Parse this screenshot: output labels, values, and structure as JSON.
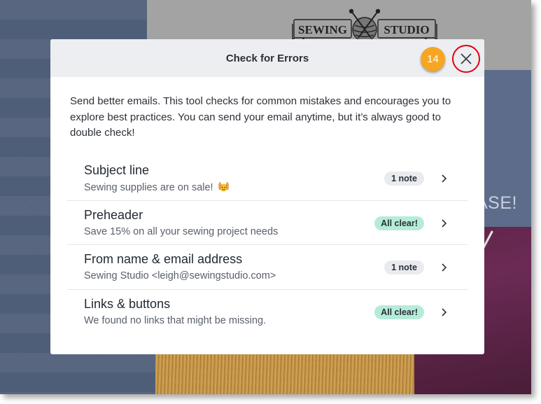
{
  "background": {
    "logo_text_left": "SEWING",
    "logo_text_right": "STUDIO",
    "release_text": "ASE!"
  },
  "modal": {
    "title": "Check for Errors",
    "step_badge": "14",
    "close_icon": "close-icon",
    "intro": "Send better emails. This tool checks for common mistakes and encourages you to explore best practices. You can send your email anytime, but it’s always good to double check!",
    "items": [
      {
        "title": "Subject line",
        "subtitle": "Sewing supplies are on sale!",
        "status": "1 note",
        "status_type": "note",
        "emoji": "raising-hands-emoji"
      },
      {
        "title": "Preheader",
        "subtitle": "Save 15% on all your sewing project needs",
        "status": "All clear!",
        "status_type": "clear"
      },
      {
        "title": "From name & email address",
        "subtitle": "Sewing Studio <leigh@sewingstudio.com>",
        "status": "1 note",
        "status_type": "note"
      },
      {
        "title": "Links & buttons",
        "subtitle": "We found no links that might be missing.",
        "status": "All clear!",
        "status_type": "clear"
      }
    ]
  },
  "colors": {
    "accent_orange": "#f5a623",
    "highlight_red": "#e3000f",
    "clear_badge": "#b5ecd9",
    "note_badge": "#e9ebee"
  }
}
